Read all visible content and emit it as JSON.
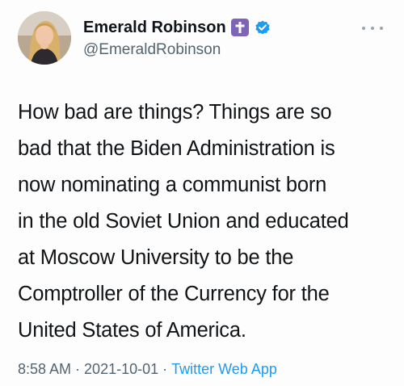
{
  "tweet": {
    "author": {
      "display_name": "Emerald Robinson",
      "handle": "@EmeraldRobinson",
      "badges": [
        "cross-icon",
        "verified-icon"
      ],
      "avatar": "avatar"
    },
    "more_icon": "more-icon",
    "lines": [
      "How bad are things? Things are so",
      "bad that the Biden Administration is",
      "now nominating a communist born",
      "in the old Soviet Union and educated",
      "at Moscow University to be the",
      "Comptroller of the Currency for the",
      "United States of America."
    ],
    "time": "8:58 AM",
    "date": "2021-10-01",
    "separator": "·",
    "source": "Twitter Web App"
  },
  "colors": {
    "badge_purple": "#7d64b8",
    "verified_blue": "#1d9bf0",
    "secondary_text": "#536471"
  }
}
